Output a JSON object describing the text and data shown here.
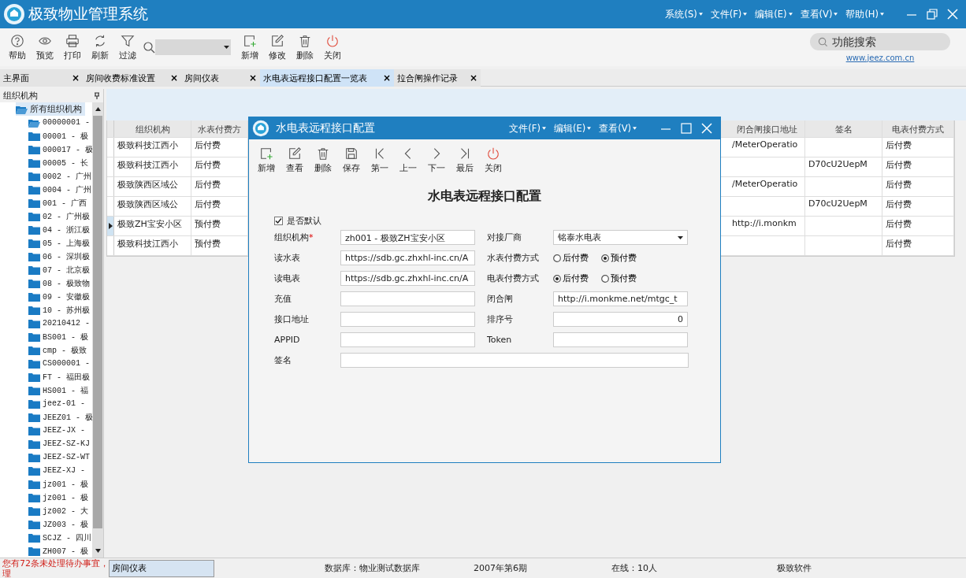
{
  "window": {
    "title": "极致物业管理系统",
    "menus": [
      "系统(S)",
      "文件(F)",
      "编辑(E)",
      "查看(V)",
      "帮助(H)"
    ]
  },
  "toolbar": {
    "left": [
      "帮助",
      "预览",
      "打印",
      "刷新",
      "过滤"
    ],
    "right": [
      "新增",
      "修改",
      "删除",
      "关闭"
    ],
    "search": {
      "placeholder": "功能搜索"
    },
    "link": "www.jeez.com.cn"
  },
  "tabs": [
    {
      "label": "主界面",
      "selected": false,
      "close": "×"
    },
    {
      "label": "房间收费标准设置",
      "selected": false,
      "close": "×"
    },
    {
      "label": "房间仪表",
      "selected": false,
      "close": "×"
    },
    {
      "label": "水电表远程接口配置一览表",
      "selected": true,
      "close": "×"
    },
    {
      "label": "拉合闸操作记录",
      "selected": false,
      "close": "×"
    }
  ],
  "sidebar": {
    "title": "组织机构",
    "root": {
      "label": "所有组织机构",
      "selected": true,
      "children": [
        {
          "label": "00000001 -",
          "expanded": true
        },
        {
          "label": "00001 - 极",
          "expanded": false
        },
        {
          "label": "000017 - 极",
          "expanded": false
        },
        {
          "label": "00005 - 长",
          "expanded": false
        },
        {
          "label": "0002 - 广州",
          "expanded": false
        },
        {
          "label": "0004 - 广州",
          "expanded": false
        },
        {
          "label": "001 - 广西",
          "expanded": false
        },
        {
          "label": "02 - 广州极",
          "expanded": false
        },
        {
          "label": "04 - 浙江极",
          "expanded": false
        },
        {
          "label": "05 - 上海极",
          "expanded": false
        },
        {
          "label": "06 - 深圳极",
          "expanded": false
        },
        {
          "label": "07 - 北京极",
          "expanded": false
        },
        {
          "label": "08 - 极致物",
          "expanded": false
        },
        {
          "label": "09 - 安徽极",
          "expanded": false
        },
        {
          "label": "10 - 苏州极",
          "expanded": false
        },
        {
          "label": "20210412 -",
          "expanded": false
        },
        {
          "label": "BS001 - 极",
          "expanded": false
        },
        {
          "label": "cmp - 极致",
          "expanded": false
        },
        {
          "label": "CS000001 -",
          "expanded": false
        },
        {
          "label": "FT - 福田极",
          "expanded": false
        },
        {
          "label": "HS001 - 福",
          "expanded": false
        },
        {
          "label": "jeez-01 -",
          "expanded": false
        },
        {
          "label": "JEEZ01 - 极",
          "expanded": false
        },
        {
          "label": "JEEZ-JX -",
          "expanded": false
        },
        {
          "label": "JEEZ-SZ-KJ",
          "expanded": false
        },
        {
          "label": "JEEZ-SZ-WT",
          "expanded": false
        },
        {
          "label": "JEEZ-XJ -",
          "expanded": false
        },
        {
          "label": "jz001 - 极",
          "expanded": false
        },
        {
          "label": "jz001 - 极",
          "expanded": false
        },
        {
          "label": "jz002 - 大",
          "expanded": false
        },
        {
          "label": "JZ003 - 极",
          "expanded": false
        },
        {
          "label": "SCJZ - 四川",
          "expanded": false
        },
        {
          "label": "ZH007 - 极",
          "expanded": false
        }
      ]
    }
  },
  "table": {
    "columns_left": [
      "组织机构",
      "水表付费方"
    ],
    "columns_right": [
      "闭合闸接口地址",
      "签名",
      "电表付费方式"
    ],
    "rows": [
      {
        "selected": false,
        "left": [
          "极致科技江西小",
          "后付费"
        ],
        "right": {
          "gate_address": "/MeterOperatio",
          "electric_payment": "后付费"
        }
      },
      {
        "selected": false,
        "left": [
          "极致科技江西小",
          "后付费"
        ],
        "right": {
          "signature": "D70cU2UepM",
          "electric_payment": "后付费"
        }
      },
      {
        "selected": false,
        "left": [
          "极致陕西区域公",
          "后付费"
        ],
        "right": {
          "gate_address": "/MeterOperatio",
          "electric_payment": "后付费"
        }
      },
      {
        "selected": false,
        "left": [
          "极致陕西区域公",
          "后付费"
        ],
        "right": {
          "signature": "D70cU2UepM",
          "electric_payment": "后付费"
        }
      },
      {
        "selected": true,
        "left": [
          "极致ZH宝安小区",
          "预付费"
        ],
        "right": {
          "gate_address": "http://i.monkm",
          "electric_payment": "后付费"
        }
      },
      {
        "selected": false,
        "left": [
          "极致科技江西小",
          "预付费"
        ],
        "right": {
          "electric_payment": "后付费"
        }
      }
    ]
  },
  "dialog": {
    "title": "水电表远程接口配置",
    "menus": [
      "文件(F)",
      "编辑(E)",
      "查看(V)"
    ],
    "toolbar": [
      "新增",
      "查看",
      "删除",
      "保存",
      "第一",
      "上一",
      "下一",
      "最后",
      "关闭"
    ],
    "heading": "水电表远程接口配置",
    "default_checkbox": {
      "label": "是否默认",
      "checked": true
    },
    "fields": [
      {
        "kind": "text",
        "label": "组织机构",
        "mark": "*",
        "value": "zh001 - 极致ZH宝安小区"
      },
      {
        "kind": "select",
        "label": "对接厂商",
        "value": "铭泰水电表"
      },
      {
        "kind": "text",
        "label": "读水表",
        "value": "https://sdb.gc.zhxhl-inc.cn/A"
      },
      {
        "kind": "radio",
        "label": "水表付费方式",
        "options": [
          {
            "label": "后付费",
            "selected": false
          },
          {
            "label": "预付费",
            "selected": true
          }
        ]
      },
      {
        "kind": "text",
        "label": "读电表",
        "value": "https://sdb.gc.zhxhl-inc.cn/A"
      },
      {
        "kind": "radio",
        "label": "电表付费方式",
        "options": [
          {
            "label": "后付费",
            "selected": true
          },
          {
            "label": "预付费",
            "selected": false
          }
        ]
      },
      {
        "kind": "text",
        "label": "充值"
      },
      {
        "kind": "text",
        "label": "闭合闸",
        "value": "http://i.monkme.net/mtgc_t"
      },
      {
        "kind": "text",
        "label": "接口地址"
      },
      {
        "kind": "number",
        "label": "排序号",
        "value": "0"
      },
      {
        "kind": "text",
        "label": "APPID"
      },
      {
        "kind": "text",
        "label": "Token"
      },
      {
        "kind": "wide",
        "label": "签名"
      }
    ]
  },
  "status_bar": {
    "notice": "您有72条未处理待办事宜，理",
    "task": "房间仪表",
    "items": [
      "数据库：物业测试数据库",
      "2007年第6期",
      "在线：10人",
      "极致软件"
    ]
  }
}
